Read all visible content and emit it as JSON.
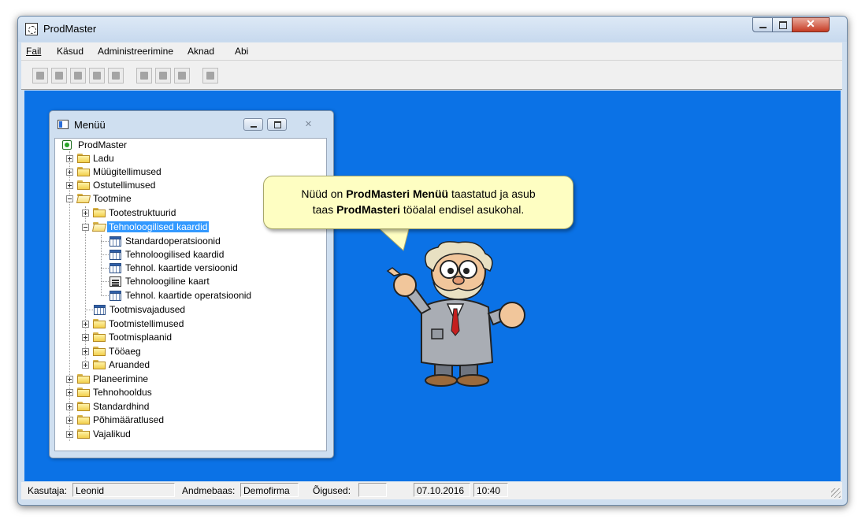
{
  "window": {
    "title": "ProdMaster",
    "close_glyph": "✕"
  },
  "menubar": {
    "items": [
      "Fail",
      "Käsud",
      "Administreerimine",
      "Aknad",
      "Abi"
    ]
  },
  "toolbar": {
    "buttons": [
      "add-icon",
      "binoculars-icon",
      "eraser-icon",
      "stop-icon",
      "print-icon",
      "open-folder-icon",
      "folder-icon",
      "close-x-icon",
      "windows-icon"
    ]
  },
  "menu_window": {
    "title": "Menüü",
    "close_glyph": "✕",
    "tree": [
      {
        "label": "ProdMaster"
      },
      {
        "label": "Ladu"
      },
      {
        "label": "Müügitellimused"
      },
      {
        "label": "Ostutellimused"
      },
      {
        "label": "Tootmine"
      },
      {
        "label": "Tootestruktuurid"
      },
      {
        "label": "Tehnoloogilised kaardid"
      },
      {
        "label": "Standardoperatsioonid"
      },
      {
        "label": "Tehnoloogilised kaardid"
      },
      {
        "label": "Tehnol. kaartide versioonid"
      },
      {
        "label": "Tehnoloogiline kaart"
      },
      {
        "label": "Tehnol. kaartide operatsioonid"
      },
      {
        "label": "Tootmisvajadused"
      },
      {
        "label": "Tootmistellimused"
      },
      {
        "label": "Tootmisplaanid"
      },
      {
        "label": "Tööaeg"
      },
      {
        "label": "Aruanded"
      },
      {
        "label": "Planeerimine"
      },
      {
        "label": "Tehnohooldus"
      },
      {
        "label": "Standardhind"
      },
      {
        "label": "Põhimääratlused"
      },
      {
        "label": "Vajalikud"
      }
    ]
  },
  "callout": {
    "line1_pre": "Nüüd on ",
    "line1_bold": "ProdMasteri Menüü",
    "line1_post": " taastatud ja asub",
    "line2_pre": "taas ",
    "line2_bold": "ProdMasteri",
    "line2_post": " tööalal endisel asukohal."
  },
  "statusbar": {
    "user_label": "Kasutaja:",
    "user_value": "Leonid",
    "db_label": "Andmebaas:",
    "db_value": "Demofirma",
    "rights_label": "Õigused:",
    "rights_value": "",
    "date": "07.10.2016",
    "time": "10:40"
  },
  "colors": {
    "workspace": "#0b72e6",
    "selection": "#3399ff",
    "callout_bg": "#fefec2"
  }
}
